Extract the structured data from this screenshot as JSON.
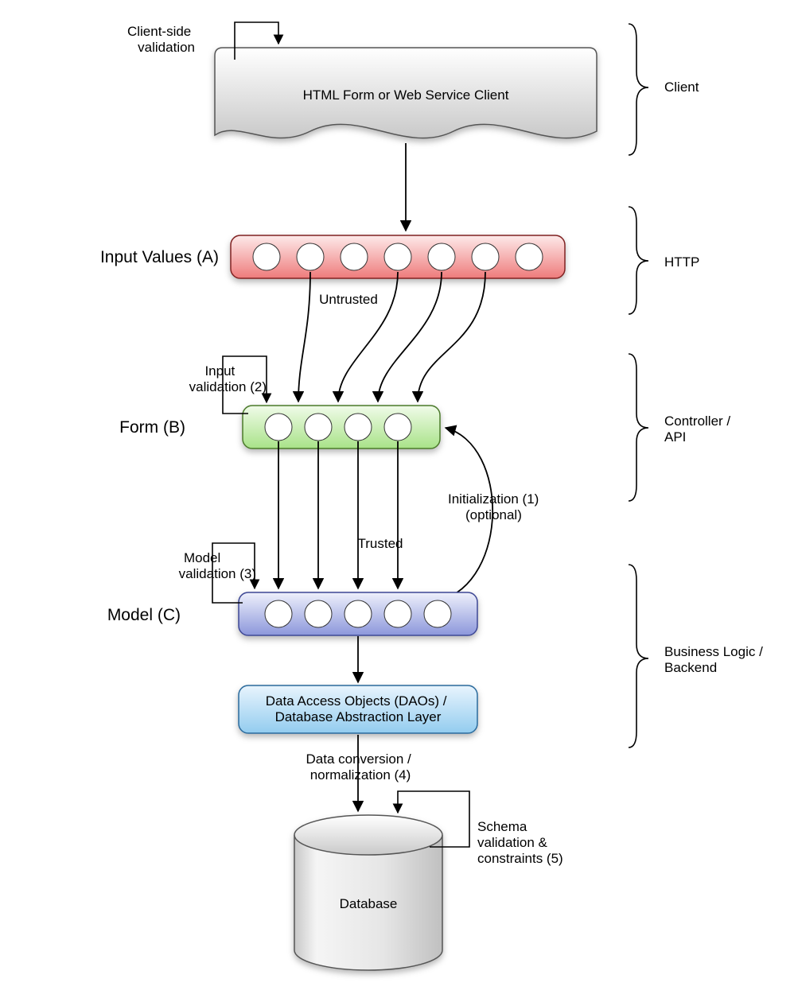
{
  "nodes": {
    "client_box": "HTML Form or Web Service Client",
    "input_values": "Input Values (A)",
    "form": "Form (B)",
    "model": "Model (C)",
    "dao_line1": "Data Access Objects (DAOs) /",
    "dao_line2": "Database Abstraction Layer",
    "database": "Database"
  },
  "annotations": {
    "client_side_line1": "Client-side",
    "client_side_line2": "validation",
    "untrusted": "Untrusted",
    "input_val_line1": "Input",
    "input_val_line2": "validation (2)",
    "init_line1": "Initialization (1)",
    "init_line2": "(optional)",
    "model_val_line1": "Model",
    "model_val_line2": "validation (3)",
    "trusted": "Trusted",
    "dataconv_line1": "Data conversion /",
    "dataconv_line2": "normalization (4)",
    "schema_line1": "Schema",
    "schema_line2": "validation &",
    "schema_line3": "constraints (5)"
  },
  "layers": {
    "client": "Client",
    "http": "HTTP",
    "controller_line1": "Controller /",
    "controller_line2": "API",
    "business_line1": "Business Logic /",
    "business_line2": "Backend"
  },
  "circle_counts": {
    "input_values": 7,
    "form": 4,
    "model": 5
  },
  "colors": {
    "red": "#f28f8f",
    "green": "#b4e89a",
    "purple": "#9ea7e0",
    "blue": "#a9d8f5",
    "grey": "#d9d9d9"
  }
}
